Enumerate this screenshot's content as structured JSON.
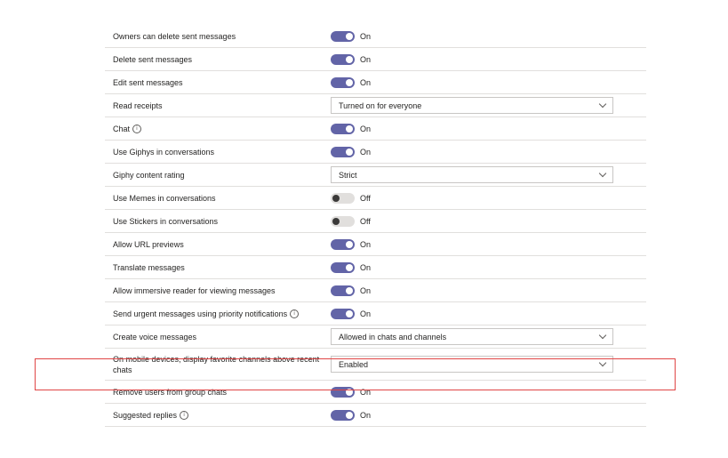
{
  "settings": [
    {
      "label": "Owners can delete sent messages",
      "type": "toggle",
      "state": "on",
      "value": "On"
    },
    {
      "label": "Delete sent messages",
      "type": "toggle",
      "state": "on",
      "value": "On"
    },
    {
      "label": "Edit sent messages",
      "type": "toggle",
      "state": "on",
      "value": "On"
    },
    {
      "label": "Read receipts",
      "type": "dropdown",
      "value": "Turned on for everyone"
    },
    {
      "label": "Chat",
      "info": true,
      "type": "toggle",
      "state": "on",
      "value": "On"
    },
    {
      "label": "Use Giphys in conversations",
      "type": "toggle",
      "state": "on",
      "value": "On"
    },
    {
      "label": "Giphy content rating",
      "type": "dropdown",
      "value": "Strict"
    },
    {
      "label": "Use Memes in conversations",
      "type": "toggle",
      "state": "off",
      "value": "Off"
    },
    {
      "label": "Use Stickers in conversations",
      "type": "toggle",
      "state": "off",
      "value": "Off"
    },
    {
      "label": "Allow URL previews",
      "type": "toggle",
      "state": "on",
      "value": "On"
    },
    {
      "label": "Translate messages",
      "type": "toggle",
      "state": "on",
      "value": "On"
    },
    {
      "label": "Allow immersive reader for viewing messages",
      "type": "toggle",
      "state": "on",
      "value": "On"
    },
    {
      "label": "Send urgent messages using priority notifications",
      "info": true,
      "type": "toggle",
      "state": "on",
      "value": "On"
    },
    {
      "label": "Create voice messages",
      "type": "dropdown",
      "value": "Allowed in chats and channels"
    },
    {
      "label": "On mobile devices, display favorite channels above recent chats",
      "type": "dropdown",
      "value": "Enabled",
      "highlighted": true
    },
    {
      "label": "Remove users from group chats",
      "type": "toggle",
      "state": "on",
      "value": "On"
    },
    {
      "label": "Suggested replies",
      "info": true,
      "type": "toggle",
      "state": "on",
      "value": "On"
    }
  ],
  "colors": {
    "toggle_on": "#6264a7",
    "toggle_off": "#e1dfdd",
    "highlight_border": "#e04545"
  },
  "icons": {
    "info": "info-icon",
    "dropdown": "chevron-down-icon"
  }
}
